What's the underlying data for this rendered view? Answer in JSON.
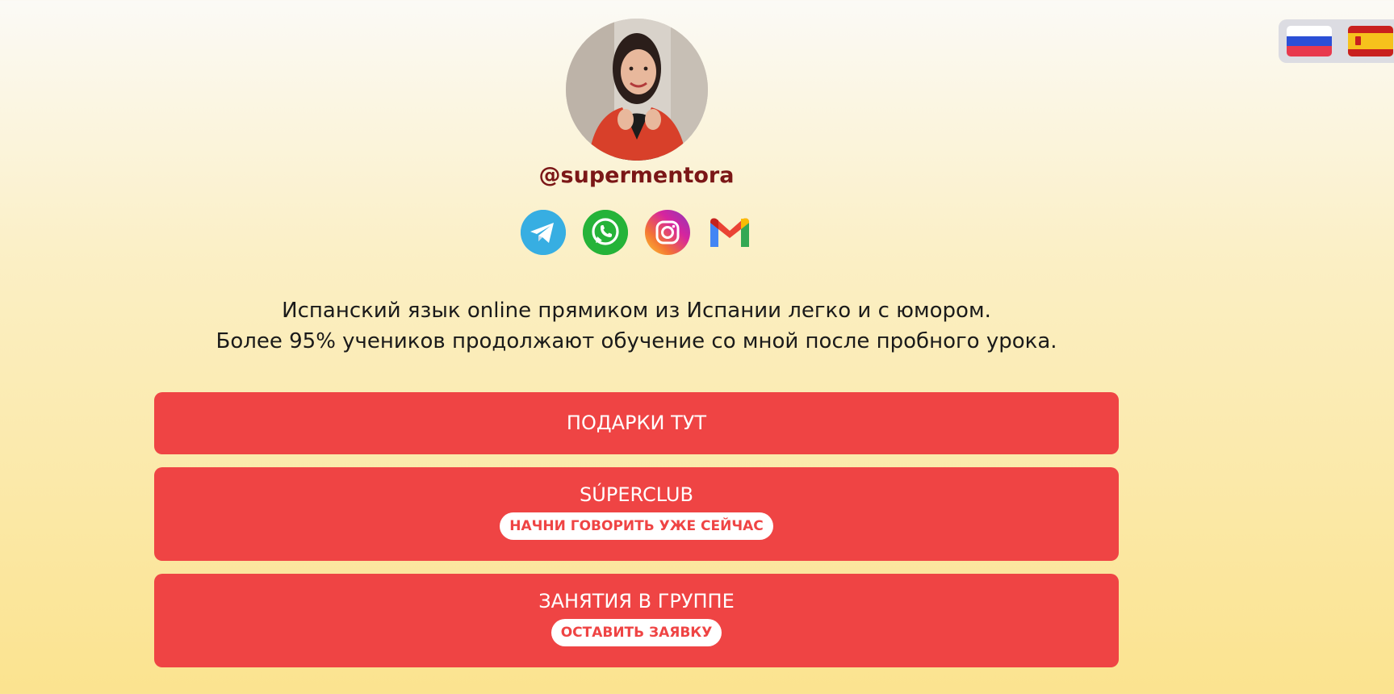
{
  "profile": {
    "username": "@supermentora"
  },
  "socials": [
    {
      "name": "telegram",
      "icon": "telegram-icon",
      "color": "#2aabee"
    },
    {
      "name": "whatsapp",
      "icon": "whatsapp-icon",
      "color": "#25b339"
    },
    {
      "name": "instagram",
      "icon": "instagram-icon",
      "color": "#d6249f"
    },
    {
      "name": "gmail",
      "icon": "gmail-icon",
      "color": "#ea4335"
    }
  ],
  "tagline": {
    "line1": "Испанский язык online прямиком из Испании легко и с юмором.",
    "line2": "Более 95% учеников продолжают обучение со мной после пробного урока."
  },
  "buttons": [
    {
      "title": "ПОДАРКИ ТУТ"
    },
    {
      "title": "SÚPERCLUB",
      "subtitle": "НАЧНИ ГОВОРИТЬ УЖЕ СЕЙЧАС"
    },
    {
      "title": "ЗАНЯТИЯ В ГРУППЕ",
      "subtitle": "ОСТАВИТЬ ЗАЯВКУ"
    }
  ],
  "languages": [
    {
      "code": "ru",
      "icon": "russian-flag-icon"
    },
    {
      "code": "es",
      "icon": "spanish-flag-icon"
    }
  ],
  "colors": {
    "accent": "#ef4444",
    "username": "#7b1717",
    "background_top": "#fbfaf6",
    "background_bottom": "#fbe38f"
  }
}
